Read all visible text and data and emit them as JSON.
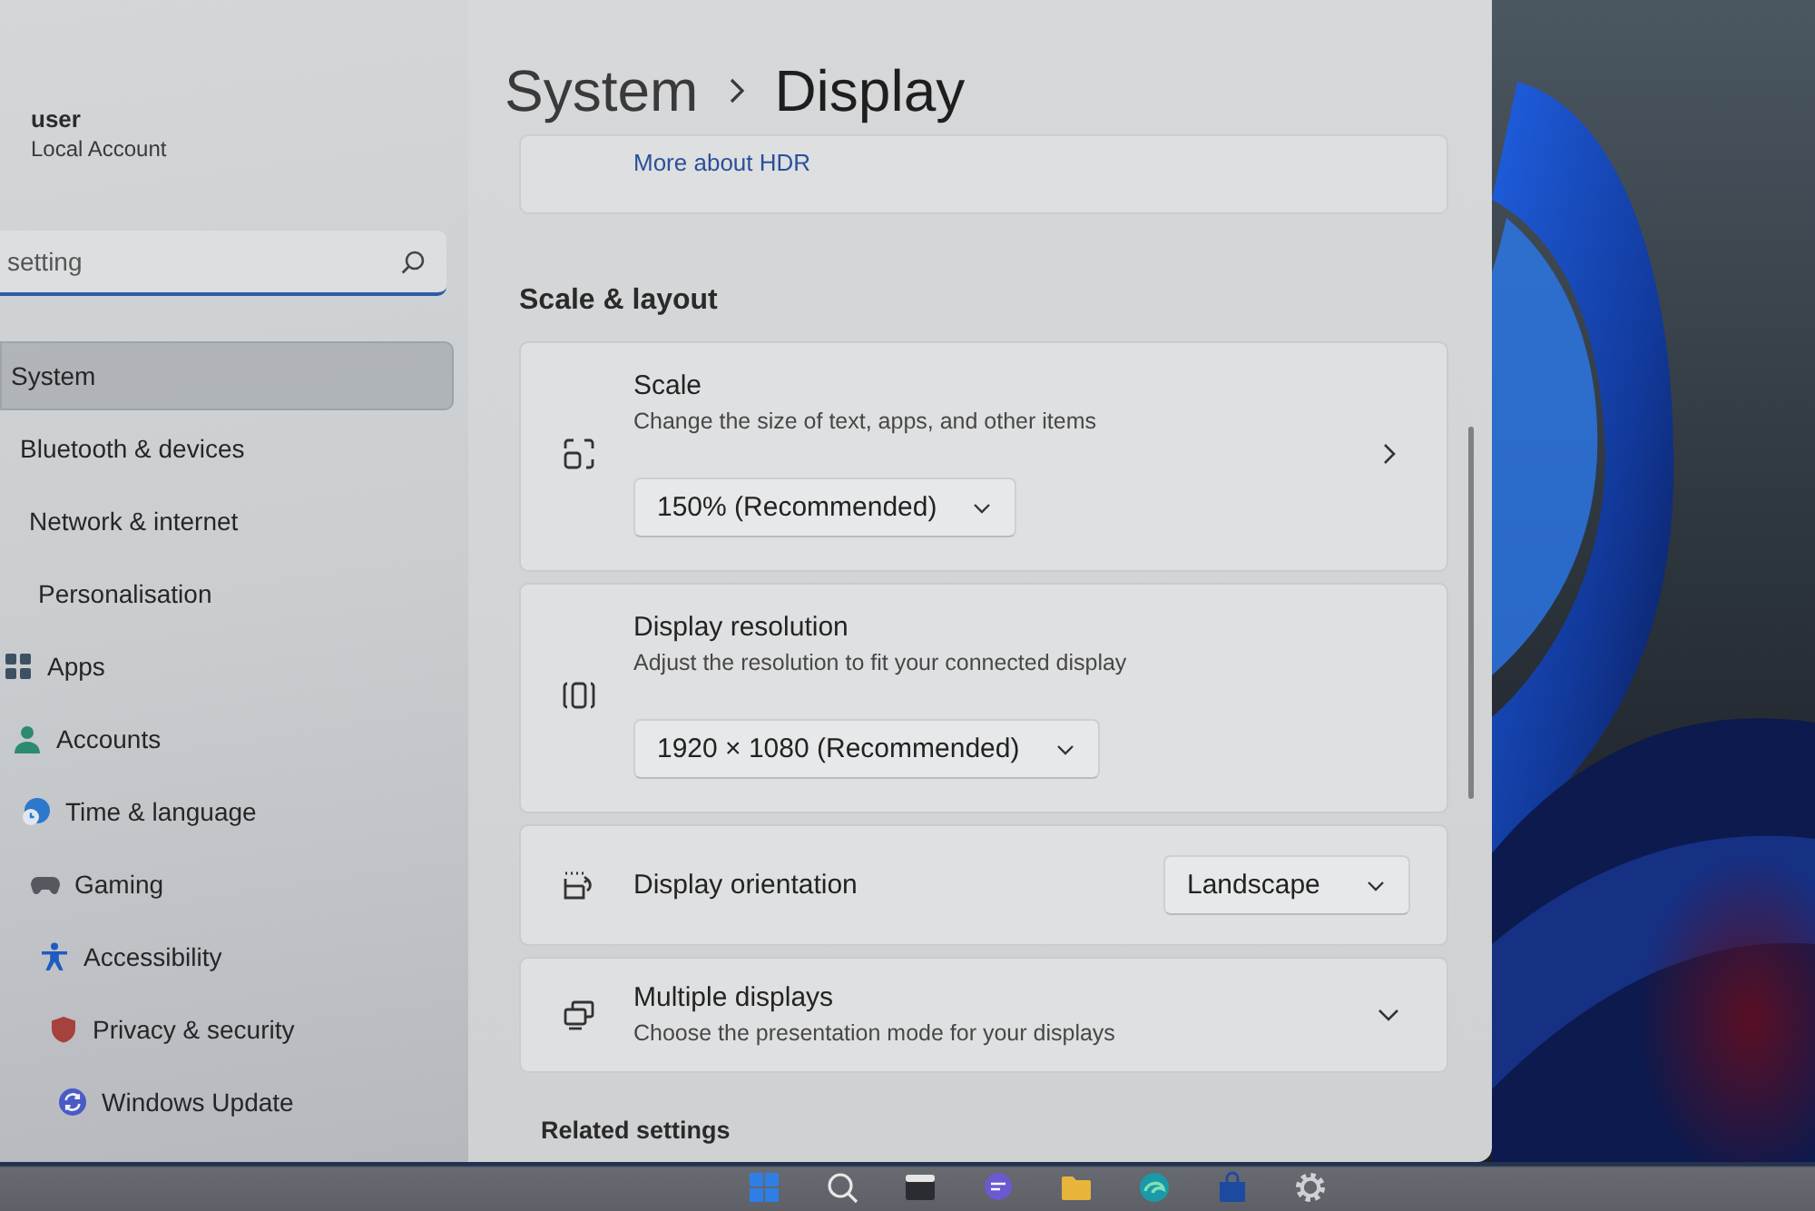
{
  "sidebar": {
    "user": {
      "name": "user",
      "account_type": "Local Account"
    },
    "search": {
      "value": "setting"
    },
    "nav": [
      {
        "label": "System",
        "selected": true
      },
      {
        "label": "Bluetooth & devices",
        "selected": false
      },
      {
        "label": "Network & internet",
        "selected": false
      },
      {
        "label": "Personalisation",
        "selected": false
      },
      {
        "label": "Apps",
        "selected": false
      },
      {
        "label": "Accounts",
        "selected": false
      },
      {
        "label": "Time & language",
        "selected": false
      },
      {
        "label": "Gaming",
        "selected": false
      },
      {
        "label": "Accessibility",
        "selected": false
      },
      {
        "label": "Privacy & security",
        "selected": false
      },
      {
        "label": "Windows Update",
        "selected": false
      }
    ]
  },
  "header": {
    "breadcrumb_parent": "System",
    "title": "Display"
  },
  "hdr_card": {
    "link": "More about HDR"
  },
  "section": {
    "title": "Scale & layout"
  },
  "settings": [
    {
      "kind": "stacked",
      "title": "Scale",
      "subtitle": "Change the size of text, apps, and other items",
      "value": "150% (Recommended)",
      "navigates": true
    },
    {
      "kind": "stacked",
      "title": "Display resolution",
      "subtitle": "Adjust the resolution to fit your connected display",
      "value": "1920 × 1080 (Recommended)",
      "navigates": false
    },
    {
      "kind": "inline",
      "title": "Display orientation",
      "value": "Landscape"
    },
    {
      "kind": "expander",
      "title": "Multiple displays",
      "subtitle": "Choose the presentation mode for your displays",
      "expanded": false
    }
  ],
  "related": {
    "title": "Related settings"
  }
}
